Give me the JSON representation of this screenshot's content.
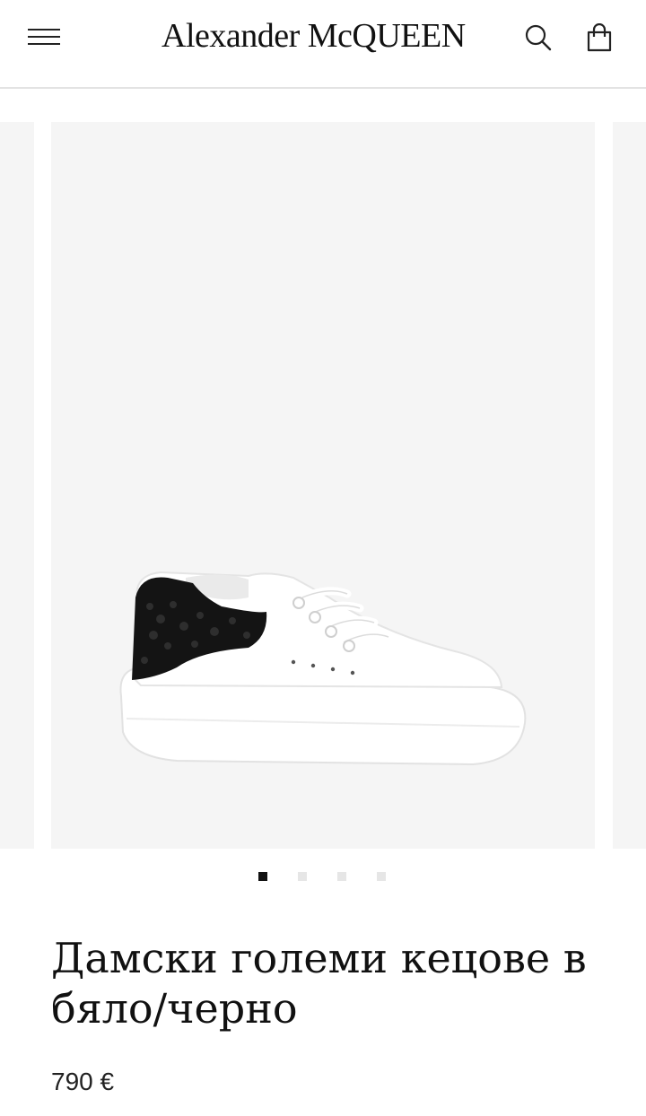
{
  "header": {
    "logo": "Alexander McQUEEN",
    "menu_icon": "hamburger-menu-icon",
    "search_icon": "search-icon",
    "bag_icon": "shopping-bag-icon"
  },
  "gallery": {
    "image": "white-sneaker-with-black-crystal-heel-image",
    "total_slides": 4,
    "active_slide": 1
  },
  "product": {
    "title": "Дамски големи кецове в бяло/черно",
    "price": "790 €"
  }
}
